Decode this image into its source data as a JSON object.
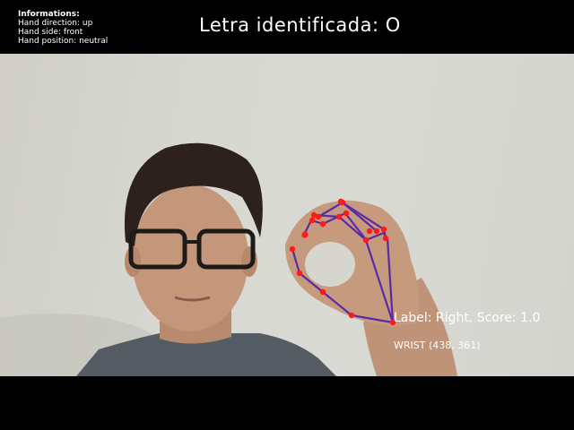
{
  "info": {
    "title": "Informations:",
    "direction": "Hand direction: up",
    "side": "Hand side: front",
    "position": "Hand position: neutral"
  },
  "letter": {
    "text": "Letra identificada: O"
  },
  "detection": {
    "hand_label": "Label: Right, Score: 1.0",
    "landmark_label": "WRIST (438, 361)"
  },
  "colors": {
    "landmark_point": "#ff1a1a",
    "connection_line": "#5a2aa8",
    "text": "#ffffff",
    "background": "#000000"
  }
}
